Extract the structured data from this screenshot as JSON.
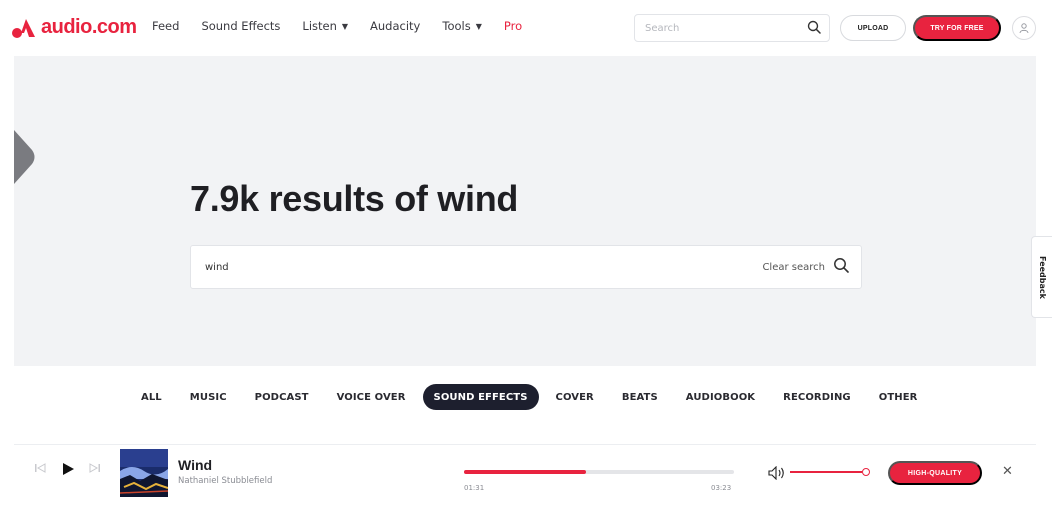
{
  "header": {
    "logo_text": "audio.com",
    "nav": [
      {
        "label": "Feed",
        "dropdown": false
      },
      {
        "label": "Sound Effects",
        "dropdown": false
      },
      {
        "label": "Listen",
        "dropdown": true
      },
      {
        "label": "Audacity",
        "dropdown": false
      },
      {
        "label": "Tools",
        "dropdown": true
      },
      {
        "label": "Pro",
        "dropdown": false
      }
    ],
    "search_placeholder": "Search",
    "upload_label": "UPLOAD",
    "try_label": "TRY FOR FREE"
  },
  "hero": {
    "title": "7.9k results of wind",
    "search_value": "wind",
    "clear_label": "Clear search"
  },
  "feedback_label": "Feedback",
  "filters": [
    {
      "label": "ALL",
      "active": false
    },
    {
      "label": "MUSIC",
      "active": false
    },
    {
      "label": "PODCAST",
      "active": false
    },
    {
      "label": "VOICE OVER",
      "active": false
    },
    {
      "label": "SOUND EFFECTS",
      "active": true
    },
    {
      "label": "COVER",
      "active": false
    },
    {
      "label": "BEATS",
      "active": false
    },
    {
      "label": "AUDIOBOOK",
      "active": false
    },
    {
      "label": "RECORDING",
      "active": false
    },
    {
      "label": "OTHER",
      "active": false
    }
  ],
  "player": {
    "title": "Wind",
    "artist": "Nathaniel Stubblefield",
    "current_time": "01:31",
    "duration": "03:23",
    "progress": 0.45,
    "volume": 0.95,
    "hq_label": "HIGH-QUALITY"
  },
  "colors": {
    "accent": "#e8233f",
    "chip_active": "#1d1f2e",
    "hero_bg": "#f2f3f5"
  }
}
